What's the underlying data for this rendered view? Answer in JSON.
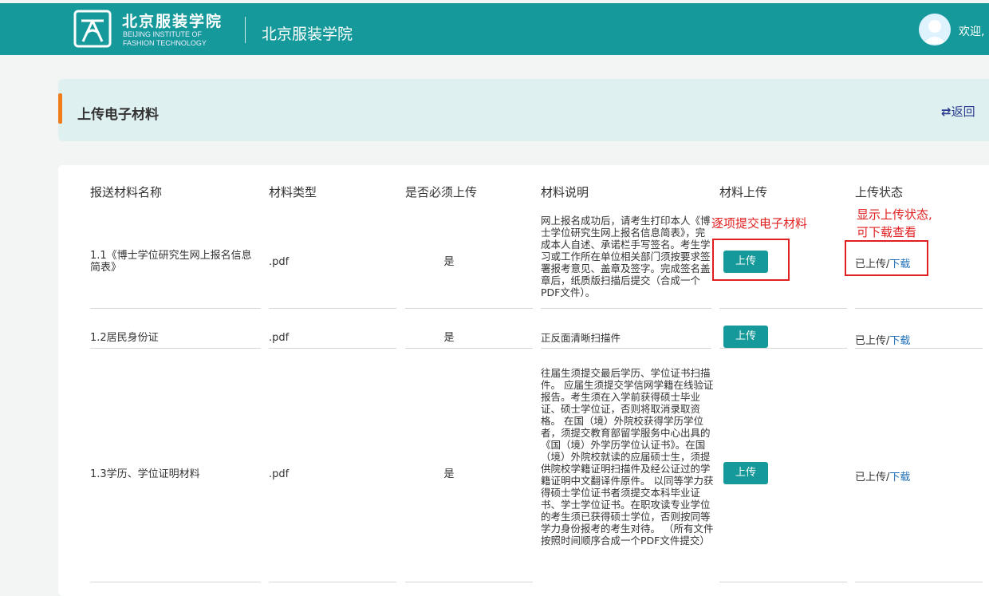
{
  "header": {
    "logo_cn": "北京服装学院",
    "logo_en_line1": "BEIJING INSTITUTE OF",
    "logo_en_line2": "FASHION TECHNOLOGY",
    "site_title": "北京服装学院",
    "welcome": "欢迎,",
    "brand_color": "#15999a"
  },
  "page": {
    "title": "上传电子材料",
    "back_label": "返回",
    "back_icon": "swap-arrows-icon"
  },
  "table": {
    "columns": [
      "报送材料名称",
      "材料类型",
      "是否必须上传",
      "材料说明",
      "材料上传",
      "上传状态"
    ],
    "rows": [
      {
        "name": "1.1《博士学位研究生网上报名信息简表》",
        "type": ".pdf",
        "required": "是",
        "description": "网上报名成功后，请考生打印本人《博士学位研究生网上报名信息简表》，完成本人自述、承诺栏手写签名。考生学习或工作所在单位相关部门须按要求签署报考意见、盖章及签字。完成签名盖章后，纸质版扫描后提交（合成一个PDF文件）。",
        "upload_label": "上传",
        "status_text": "已上传/",
        "download_label": "下载"
      },
      {
        "name": "1.2居民身份证",
        "type": ".pdf",
        "required": "是",
        "description": "正反面清晰扫描件",
        "upload_label": "上传",
        "status_text": "已上传/",
        "download_label": "下载"
      },
      {
        "name": "1.3学历、学位证明材料",
        "type": ".pdf",
        "required": "是",
        "description": "往届生须提交最后学历、学位证书扫描件。 应届生须提交学信网学籍在线验证报告。考生须在入学前获得硕士毕业证、硕士学位证，否则将取消录取资格。 在国（境）外院校获得学历学位者，须提交教育部留学服务中心出具的《国（境）外学历学位认证书》。在国（境）外院校就读的应届硕士生，须提供院校学籍证明扫描件及经公证过的学籍证明中文翻译件原件。 以同等学力获得硕士学位证书者须提交本科毕业证书、学士学位证书。在职攻读专业学位的考生须已获得硕士学位，否则按同等学力身份报考的考生对待。 （所有文件按照时间顺序合成一个PDF文件提交）",
        "upload_label": "上传",
        "status_text": "已上传/",
        "download_label": "下载"
      }
    ]
  },
  "annotations": {
    "upload_note": "逐项提交电子材料",
    "status_note_line1": "显示上传状态,",
    "status_note_line2": "可下载查看",
    "color": "#e02020"
  }
}
